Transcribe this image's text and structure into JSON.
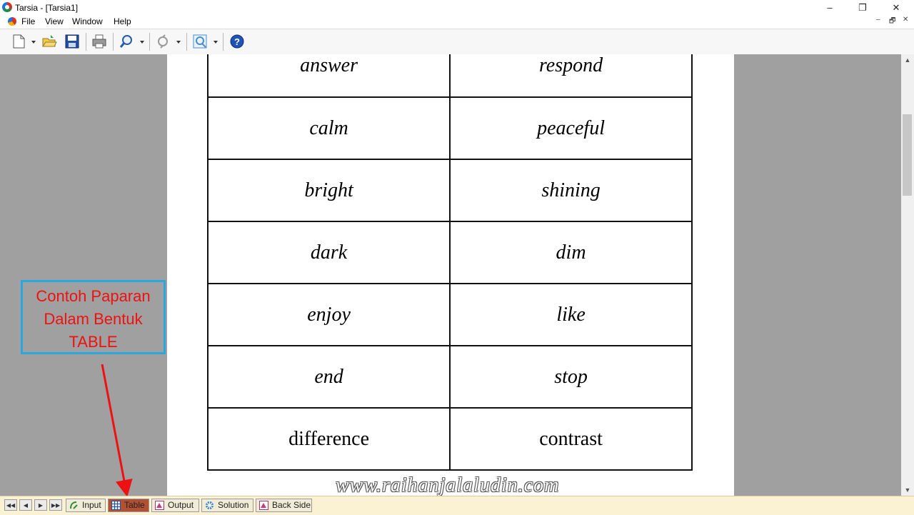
{
  "window": {
    "title": "Tarsia - [Tarsia1]",
    "controls": {
      "minimize": "–",
      "restore": "❐",
      "close": "✕"
    }
  },
  "menu": {
    "items": [
      "File",
      "View",
      "Window",
      "Help"
    ],
    "mdi_controls": {
      "minimize": "–",
      "restore": "🗗",
      "close": "✕"
    }
  },
  "toolbar": {
    "buttons": [
      "new-file-icon",
      "open-folder-icon",
      "save-icon",
      "print-icon",
      "zoom-icon",
      "transform-icon",
      "preview-icon",
      "help-icon"
    ]
  },
  "table": {
    "rows": [
      [
        "answer",
        "respond"
      ],
      [
        "calm",
        "peaceful"
      ],
      [
        "bright",
        "shining"
      ],
      [
        "dark",
        "dim"
      ],
      [
        "enjoy",
        "like"
      ],
      [
        "end",
        "stop"
      ],
      [
        "difference",
        "contrast"
      ]
    ]
  },
  "watermark": "www.raihanjalaludin.com",
  "annotation": {
    "lines": [
      "Contoh Paparan",
      "Dalam Bentuk",
      "TABLE"
    ],
    "border_color": "#29a8e0",
    "text_color": "#ee1111",
    "arrow_color": "#ee1111"
  },
  "tabs": {
    "items": [
      "Input",
      "Table",
      "Output",
      "Solution",
      "Back Side"
    ],
    "active": "Table",
    "active_color": "#b25033"
  }
}
